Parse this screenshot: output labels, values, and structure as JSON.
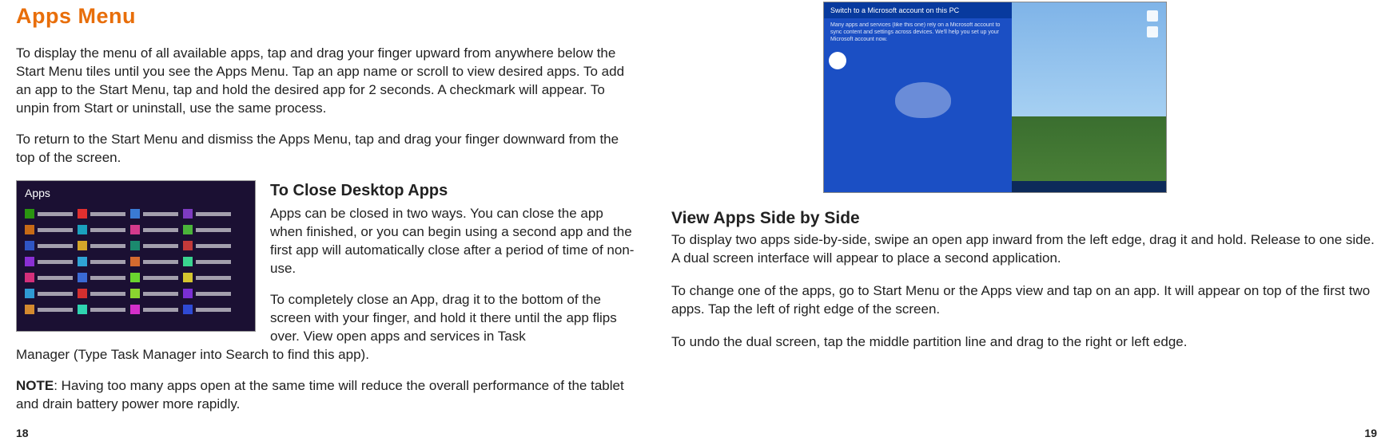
{
  "left": {
    "heading": "Apps Menu",
    "para1": "To display the menu of all available apps, tap and drag your finger upward from anywhere below the Start Menu tiles until you see the Apps Menu. Tap an app name or scroll to view desired apps. To add an app to the Start Menu, tap and hold the desired app for 2 seconds. A checkmark will appear. To unpin from Start or uninstall, use the same process.",
    "para2": "To return to the Start Menu and dismiss the Apps Menu, tap and drag your finger downward from the top of the screen.",
    "apps_label": "Apps",
    "close_heading": "To Close Desktop Apps",
    "close_para1": "Apps can be closed in two ways. You can close the app when finished, or you can begin using a second app and the first app will automatically close after a period of time of non-use.",
    "close_para2": "To completely close an App, drag it to the bottom of the screen with your finger, and hold it there until the app flips over. View open apps and services in Task",
    "close_wrap": "Manager (Type Task Manager into Search to find this app).",
    "note_label": "NOTE",
    "note_text": ": Having too many apps open at the same time will reduce the overall performance of the tablet and drain battery power more rapidly.",
    "page_num": "18"
  },
  "right": {
    "thumb_topbar": "Switch to a Microsoft account on this PC",
    "thumb_msg": "Many apps and services (like this one) rely on a Microsoft account to sync content and settings across devices. We'll help you set up your Microsoft account now.",
    "heading": "View Apps Side by Side",
    "para1": "To display two apps side-by-side, swipe an open app inward from the left edge, drag it and hold. Release to one side. A dual screen interface will appear to place a second application.",
    "para2": "To change one of the apps, go to Start Menu or the Apps view and tap on an app. It will appear on top of the first two apps. Tap the left of right edge of the screen.",
    "para3": "To undo the dual screen, tap the middle partition line and drag to the right or left edge.",
    "page_num": "19"
  }
}
